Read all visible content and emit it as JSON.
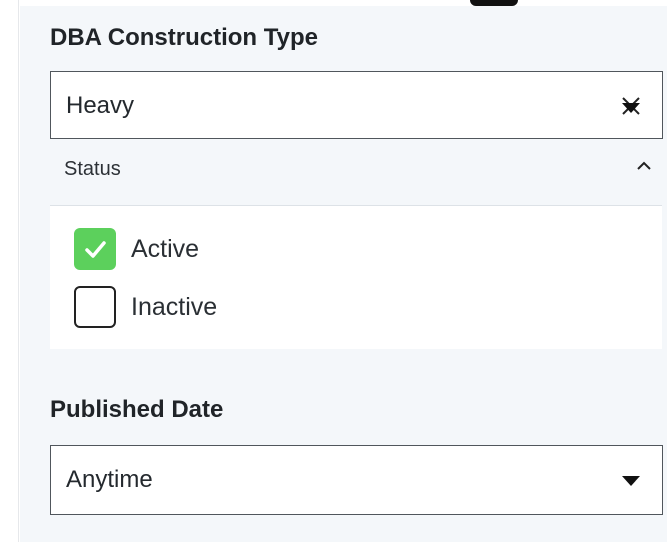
{
  "dba_section": {
    "heading": "DBA Construction Type",
    "selected_value": "Heavy"
  },
  "status_section": {
    "label": "Status",
    "options": [
      {
        "label": "Active",
        "checked": true
      },
      {
        "label": "Inactive",
        "checked": false
      }
    ]
  },
  "published_section": {
    "heading": "Published Date",
    "selected_value": "Anytime"
  },
  "icons": {
    "clear": "close-icon",
    "dropdown": "caret-down-icon",
    "collapse": "chevron-up-icon",
    "check": "check-icon"
  },
  "colors": {
    "checkbox_checked": "#5cd05c",
    "panel_background": "#f4f7fa"
  }
}
